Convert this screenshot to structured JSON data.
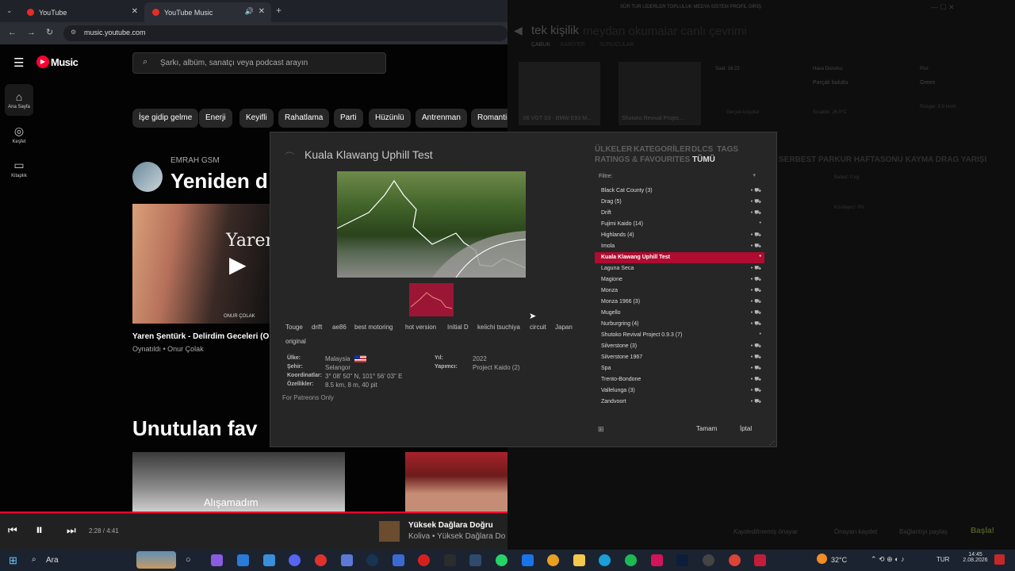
{
  "browser": {
    "tabs": [
      {
        "label": "YouTube",
        "active": false
      },
      {
        "label": "YouTube Music",
        "active": true
      }
    ],
    "new_tab": "+",
    "url": "music.youtube.com"
  },
  "ytm": {
    "logo": "Music",
    "search_placeholder": "Şarkı, albüm, sanatçı veya podcast arayın",
    "sidebar": [
      {
        "label": "Ana Sayfa",
        "icon": "home-icon",
        "glyph": "⌂"
      },
      {
        "label": "Keşfet",
        "icon": "compass-icon",
        "glyph": "◎"
      },
      {
        "label": "Kitaplık",
        "icon": "library-icon",
        "glyph": "▭"
      }
    ],
    "chips": [
      "İşe gidip gelme",
      "Enerji",
      "Keyifli",
      "Rahatlama",
      "Parti",
      "Hüzünlü",
      "Antrenman",
      "Romantik"
    ],
    "section1_artist": "EMRAH GSM",
    "section1_title": "Yeniden d",
    "card_title": "Yaren Şentürk - Delirdim Geceleri (O",
    "card_sub": "Oynatıldı • Onur Çolak",
    "card_art_text": "Yaren",
    "card_art_text2": "ONUR ÇOLAK",
    "section2_title": "Unutulan fav",
    "thumb1_text": "Alışamadım",
    "player": {
      "time": "2:28 / 4:41",
      "song": "Yüksek Dağlara Doğru",
      "artist": "Koliva • Yüksek Dağlara Do"
    }
  },
  "game": {
    "header_title": "tek kişilik",
    "header_faded": "meydan okumalar   canlı  çevrimi",
    "top_menu": "SÜR  TUR LİDERLER  TOPLULUK  MEDYA  SİSTEM  PROFİL  GİRİŞ",
    "sub_tabs": [
      "ÇABUK",
      "KARİYER",
      "SUNUCULAR"
    ],
    "car_card": "06 VGT S3 - BMW E93 M...",
    "track_card": "Shutoko Revival Projec...",
    "saat": "Saat: 16:22",
    "hava_label": "Hava Durumu:",
    "hava_value": "Parçalı bulutlu",
    "pist_label": "Pist:",
    "pist_value": "Green",
    "sicaklik": "Sıcaklık: 26.0°C",
    "ruzgar": "Rüzgar: 8.9 km/h",
    "gercek": "Gerçek koşullar",
    "modes": "SERBEST PARKUR  HAFTASONU  KAYMA  DRAG YARIŞI",
    "balast": "Balast: 0 kg",
    "kisitlayici": "Kısıtlayıcı: 0%",
    "bottom_save": "Kaydedilmemiş önayar",
    "bottom_save2": "Önayarı kaydet",
    "bottom_share": "Bağlantıyı paylaş",
    "start": "Başla!"
  },
  "dialog": {
    "title": "Kuala Klawang Uphill Test",
    "tags": [
      "Touge",
      "drift",
      "ae86",
      "best motoring",
      "hot version",
      "Initial D",
      "keiichi tsuchiya",
      "circuit",
      "Japan",
      "original"
    ],
    "info": {
      "ulke_label": "Ülke:",
      "ulke": "Malaysia",
      "sehir_label": "Şehir:",
      "sehir": "Selangor",
      "koord_label": "Koordinatlar:",
      "koord": "3° 08' 50\" N, 101° 56' 03\" E",
      "ozellik_label": "Özellikler:",
      "ozellik": "8.5 km, 8 m, 40 pit",
      "yil_label": "Yıl:",
      "yil": "2022",
      "yapimci_label": "Yapımcı:",
      "yapimci": "Project Kaido (2)"
    },
    "patreon": "For Patreons Only",
    "categories": [
      "ÜLKELER",
      "KATEGORİLER",
      "DLCS",
      "TAGS",
      "RATINGS & FAVOURITES",
      "TÜMÜ"
    ],
    "filter_label": "Filtre:",
    "tracks": [
      {
        "name": "Black Cat County (3)",
        "sel": false
      },
      {
        "name": "Drag (5)",
        "sel": false
      },
      {
        "name": "Drift",
        "sel": false
      },
      {
        "name": "Fujimi Kaido (14)",
        "sel": false
      },
      {
        "name": "Highlands (4)",
        "sel": false
      },
      {
        "name": "Imola",
        "sel": false
      },
      {
        "name": "Kuala Klawang Uphill Test",
        "sel": true
      },
      {
        "name": "Laguna Seca",
        "sel": false
      },
      {
        "name": "Magione",
        "sel": false
      },
      {
        "name": "Monza",
        "sel": false
      },
      {
        "name": "Monza 1966 (3)",
        "sel": false
      },
      {
        "name": "Mugello",
        "sel": false
      },
      {
        "name": "Nurburgring (4)",
        "sel": false
      },
      {
        "name": "Shutoko Revival Project 0.9.3 (7)",
        "sel": false
      },
      {
        "name": "Silverstone (3)",
        "sel": false
      },
      {
        "name": "Silverstone 1967",
        "sel": false
      },
      {
        "name": "Spa",
        "sel": false
      },
      {
        "name": "Trento-Bondone",
        "sel": false
      },
      {
        "name": "Vallelunga (3)",
        "sel": false
      },
      {
        "name": "Zandvoort",
        "sel": false
      }
    ],
    "ok": "Tamam",
    "cancel": "İptal"
  },
  "taskbar": {
    "search": "Ara",
    "weather": "32°C",
    "lang": "TUR",
    "time": "14:45",
    "date": "2.08.2026"
  },
  "colors": {
    "accent": "#b00b30",
    "yt_red": "#ff0033",
    "taskbar": "#1c2330"
  }
}
